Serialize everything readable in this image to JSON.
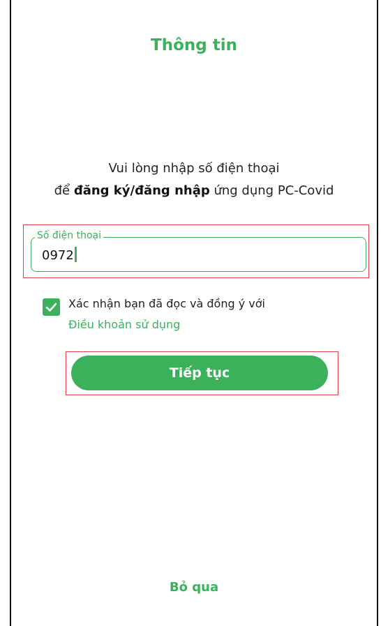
{
  "header": {
    "title": "Thông tin"
  },
  "intro": {
    "line1": "Vui lòng nhập số điện thoại",
    "line2_prefix": "để ",
    "line2_bold": "đăng ký/đăng nhập",
    "line2_suffix": " ứng dụng PC-Covid"
  },
  "phone_field": {
    "label": "Số điện thoại",
    "value": "0972"
  },
  "consent": {
    "checked": true,
    "text": "Xác nhận bạn đã đọc và đồng ý với",
    "terms_link": "Điều khoản sử dụng"
  },
  "continue_button": {
    "label": "Tiếp tục"
  },
  "skip_link": {
    "label": "Bỏ qua"
  },
  "colors": {
    "accent": "#3ab15a",
    "highlight_box": "#e0414b"
  },
  "icons": {
    "checkbox": "checkmark-icon"
  }
}
